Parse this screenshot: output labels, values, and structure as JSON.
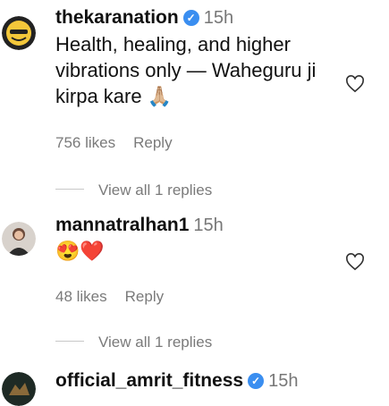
{
  "comments": [
    {
      "username": "thekaranation",
      "verified": true,
      "time": "15h",
      "text_lines": [
        "Health, healing, and higher",
        "vibrations only — Waheguru ji",
        "kirpa kare 🙏🏼"
      ],
      "likes": "756 likes",
      "reply": "Reply",
      "view_replies": "View all 1 replies"
    },
    {
      "username": "mannatralhan1",
      "verified": false,
      "time": "15h",
      "text": "😍❤️",
      "likes": "48 likes",
      "reply": "Reply",
      "view_replies": "View all 1 replies"
    },
    {
      "username": "official_amrit_fitness",
      "verified": true,
      "time": "15h"
    }
  ],
  "icons": {
    "like": "heart-outline-icon",
    "verified": "verified-badge-icon"
  },
  "colors": {
    "verified": "#3a8ef0",
    "muted": "#7a7a7a"
  }
}
